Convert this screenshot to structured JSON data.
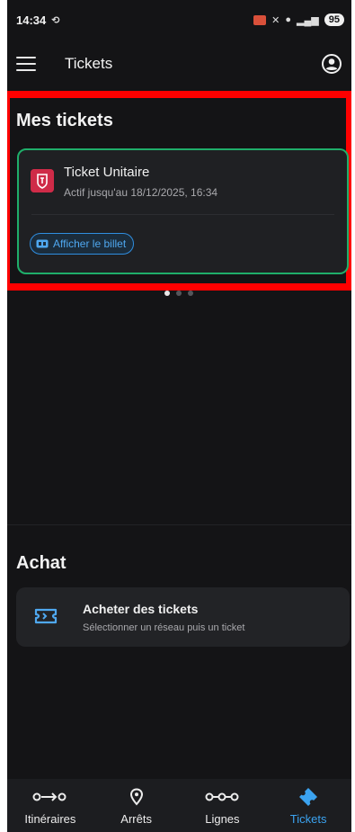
{
  "status_bar": {
    "time": "14:34",
    "battery": "95"
  },
  "app_bar": {
    "title": "Tickets"
  },
  "my_tickets": {
    "title": "Mes tickets",
    "ticket": {
      "name": "Ticket Unitaire",
      "status": "Actif jusqu'au 18/12/2025, 16:34",
      "show_label": "Afficher le billet"
    },
    "pages": {
      "count": 3,
      "current": 1
    }
  },
  "purchase": {
    "title": "Achat",
    "buy": {
      "title": "Acheter des tickets",
      "subtitle": "Sélectionner un réseau puis un ticket"
    }
  },
  "bottom_nav": {
    "items": [
      {
        "label": "Itinéraires",
        "icon": "route-icon",
        "active": false
      },
      {
        "label": "Arrêts",
        "icon": "location-pin-icon",
        "active": false
      },
      {
        "label": "Lignes",
        "icon": "lines-icon",
        "active": false
      },
      {
        "label": "Tickets",
        "icon": "ticket-icon",
        "active": true
      }
    ]
  },
  "colors": {
    "background": "#141416",
    "active_border": "#1fae6a",
    "accent": "#3ba3f0",
    "highlight": "#ff0000",
    "ticket_logo": "#cf2b48"
  }
}
